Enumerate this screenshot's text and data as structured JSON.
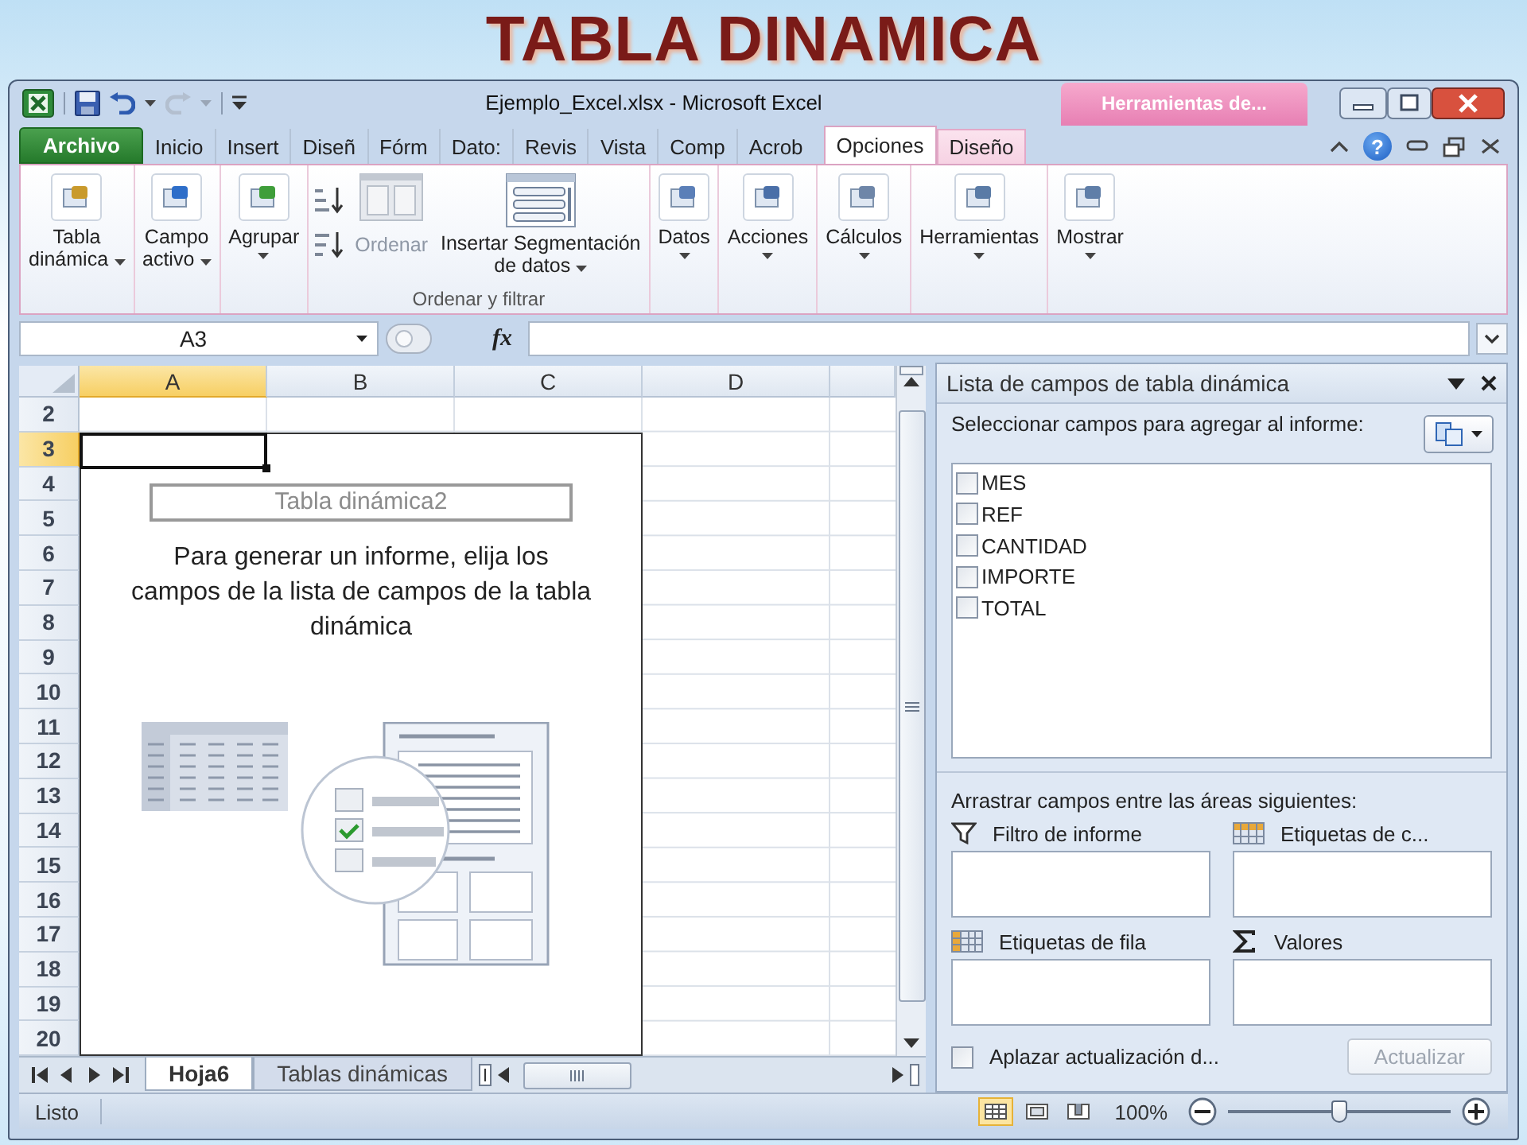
{
  "slide": {
    "title": "TABLA DINAMICA"
  },
  "window": {
    "title": "Ejemplo_Excel.xlsx - Microsoft Excel",
    "context_group": "Herramientas de...",
    "help": "?"
  },
  "tabs": [
    {
      "label": "Archivo",
      "kind": "file",
      "selected": false
    },
    {
      "label": "Inicio",
      "kind": "tab",
      "selected": false
    },
    {
      "label": "Insert",
      "kind": "tab",
      "selected": false
    },
    {
      "label": "Diseñ",
      "kind": "tab",
      "selected": false
    },
    {
      "label": "Fórm",
      "kind": "tab",
      "selected": false
    },
    {
      "label": "Dato:",
      "kind": "tab",
      "selected": false
    },
    {
      "label": "Revis",
      "kind": "tab",
      "selected": false
    },
    {
      "label": "Vista",
      "kind": "tab",
      "selected": false
    },
    {
      "label": "Comp",
      "kind": "tab",
      "selected": false
    },
    {
      "label": "Acrob",
      "kind": "tab",
      "selected": false
    },
    {
      "label": "Opciones",
      "kind": "context",
      "selected": true
    },
    {
      "label": "Diseño",
      "kind": "context",
      "selected": false
    }
  ],
  "ribbon": {
    "groups": [
      {
        "buttons": [
          {
            "kind": "large",
            "label": "Tabla\ndinámica",
            "dropdown": true,
            "disabled": false
          }
        ]
      },
      {
        "buttons": [
          {
            "kind": "large",
            "label": "Campo\nactivo",
            "dropdown": true,
            "disabled": false
          }
        ]
      },
      {
        "buttons": [
          {
            "kind": "large",
            "label": "Agrupar",
            "dropdown": true,
            "disabled": false
          }
        ]
      },
      {
        "label": "Ordenar y filtrar",
        "buttons": [
          {
            "kind": "sort",
            "label": "Ordenar",
            "disabled": true
          },
          {
            "kind": "slicer",
            "label": "Insertar Segmentación\nde datos",
            "dropdown": true,
            "disabled": false
          }
        ]
      },
      {
        "buttons": [
          {
            "kind": "large",
            "label": "Datos",
            "dropdown": true,
            "disabled": false
          }
        ]
      },
      {
        "buttons": [
          {
            "kind": "large",
            "label": "Acciones",
            "dropdown": true,
            "disabled": false
          }
        ]
      },
      {
        "buttons": [
          {
            "kind": "large",
            "label": "Cálculos",
            "dropdown": true,
            "disabled": false
          }
        ]
      },
      {
        "buttons": [
          {
            "kind": "large",
            "label": "Herramientas",
            "dropdown": true,
            "disabled": false
          }
        ]
      },
      {
        "buttons": [
          {
            "kind": "large",
            "label": "Mostrar",
            "dropdown": true,
            "disabled": false
          }
        ]
      }
    ]
  },
  "formula_bar": {
    "name_box": "A3",
    "function_label": "fx"
  },
  "sheet": {
    "columns": [
      {
        "label": "A",
        "selected": true
      },
      {
        "label": "B",
        "selected": false
      },
      {
        "label": "C",
        "selected": false
      },
      {
        "label": "D",
        "selected": false
      }
    ],
    "rows": [
      {
        "label": "2",
        "selected": false
      },
      {
        "label": "3",
        "selected": true
      },
      {
        "label": "4",
        "selected": false
      },
      {
        "label": "5",
        "selected": false
      },
      {
        "label": "6",
        "selected": false
      },
      {
        "label": "7",
        "selected": false
      },
      {
        "label": "8",
        "selected": false
      },
      {
        "label": "9",
        "selected": false
      },
      {
        "label": "10",
        "selected": false
      },
      {
        "label": "11",
        "selected": false
      },
      {
        "label": "12",
        "selected": false
      },
      {
        "label": "13",
        "selected": false
      },
      {
        "label": "14",
        "selected": false
      },
      {
        "label": "15",
        "selected": false
      },
      {
        "label": "16",
        "selected": false
      },
      {
        "label": "17",
        "selected": false
      },
      {
        "label": "18",
        "selected": false
      },
      {
        "label": "19",
        "selected": false
      },
      {
        "label": "20",
        "selected": false
      }
    ],
    "pivot_placeholder": {
      "title": "Tabla dinámica2",
      "message": "Para generar un informe, elija los campos de la lista de campos de la tabla dinámica"
    },
    "sheet_tabs": [
      {
        "label": "Hoja6",
        "selected": true
      },
      {
        "label": "Tablas dinámicas",
        "selected": false
      }
    ]
  },
  "field_list": {
    "title": "Lista de campos de tabla dinámica",
    "instruction": "Seleccionar campos para agregar al informe:",
    "fields": [
      {
        "name": "MES",
        "checked": false
      },
      {
        "name": "REF",
        "checked": false
      },
      {
        "name": "CANTIDAD",
        "checked": false
      },
      {
        "name": "IMPORTE",
        "checked": false
      },
      {
        "name": "TOTAL",
        "checked": false
      }
    ],
    "areas_instruction": "Arrastrar campos entre las áreas siguientes:",
    "areas": [
      {
        "label": "Filtro de informe",
        "kind": "filter"
      },
      {
        "label": "Etiquetas de c...",
        "kind": "columns"
      },
      {
        "label": "Etiquetas de fila",
        "kind": "rows"
      },
      {
        "label": "Valores",
        "kind": "values"
      }
    ],
    "defer": {
      "label": "Aplazar actualización d...",
      "checked": false
    },
    "update_button": {
      "label": "Actualizar",
      "disabled": true
    }
  },
  "status_bar": {
    "text": "Listo",
    "views": [
      {
        "kind": "normal",
        "selected": true
      },
      {
        "kind": "page_layout",
        "selected": false
      },
      {
        "kind": "page_break",
        "selected": false
      }
    ],
    "zoom": "100%",
    "zoom_slider": {
      "level": 0.5
    }
  }
}
